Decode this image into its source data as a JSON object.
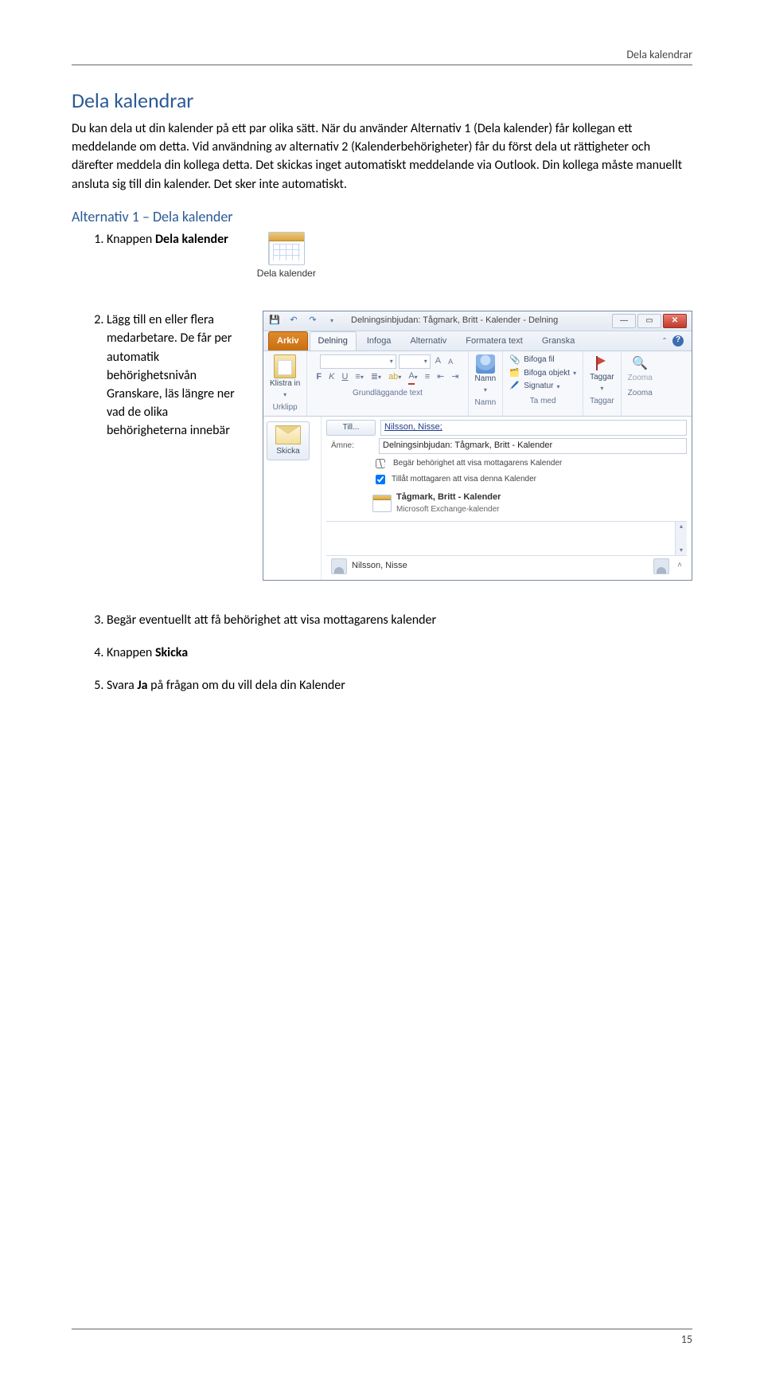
{
  "header": {
    "section_label": "Dela kalendrar"
  },
  "title": "Dela kalendrar",
  "intro_paragraph": "Du kan dela ut din kalender på ett par olika sätt. När du använder Alternativ 1 (Dela kalender) får kollegan ett meddelande om detta. Vid användning av alternativ 2 (Kalenderbehörigheter) får du först dela ut rättigheter och därefter meddela din kollega detta. Det skickas inget automatiskt meddelande via Outlook. Din kollega måste manuellt ansluta sig till din kalender. Det sker inte automatiskt.",
  "alt1_heading": "Alternativ 1 – Dela kalender",
  "step1": {
    "prefix": "Knappen ",
    "bold": "Dela kalender",
    "icon_label": "Dela kalender"
  },
  "step2": {
    "text": "Lägg till en eller flera medarbetare. De får per automatik behörighetsnivån Granskare, läs längre ner vad de olika behörigheterna innebär",
    "window": {
      "title": "Delningsinbjudan: Tågmark, Britt - Kalender  -  Delning",
      "tabs": {
        "file": "Arkiv",
        "delning": "Delning",
        "infoga": "Infoga",
        "alternativ": "Alternativ",
        "formatera": "Formatera text",
        "granska": "Granska"
      },
      "groups": {
        "urklipp": {
          "paste": "Klistra in",
          "label": "Urklipp"
        },
        "font": {
          "label": "Grundläggande text"
        },
        "namn": {
          "btn": "Namn",
          "label": "Namn"
        },
        "tamed": {
          "attach_file": "Bifoga fil",
          "attach_obj": "Bifoga objekt",
          "signature": "Signatur",
          "label": "Ta med"
        },
        "taggar": {
          "btn": "Taggar",
          "label": "Taggar"
        },
        "zoom": {
          "btn": "Zooma",
          "label": "Zooma"
        }
      },
      "compose": {
        "send": "Skicka",
        "to_btn": "Till...",
        "to_value": "Nilsson, Nisse;",
        "subject_label": "Ämne:",
        "subject_value": "Delningsinbjudan: Tågmark, Britt - Kalender",
        "chk_request": "Begär behörighet att visa mottagarens Kalender",
        "chk_allow": "Tillåt mottagaren att visa denna Kalender",
        "cal_name": "Tågmark, Britt - Kalender",
        "cal_sub": "Microsoft Exchange-kalender",
        "attendee": "Nilsson, Nisse"
      }
    }
  },
  "step3": "Begär eventuellt att få behörighet att visa mottagarens kalender",
  "step4": {
    "prefix": "Knappen ",
    "bold": "Skicka"
  },
  "step5": {
    "prefix": "Svara ",
    "bold": "Ja",
    "suffix": " på frågan om du vill dela din Kalender"
  },
  "footer": {
    "page_number": "15"
  }
}
